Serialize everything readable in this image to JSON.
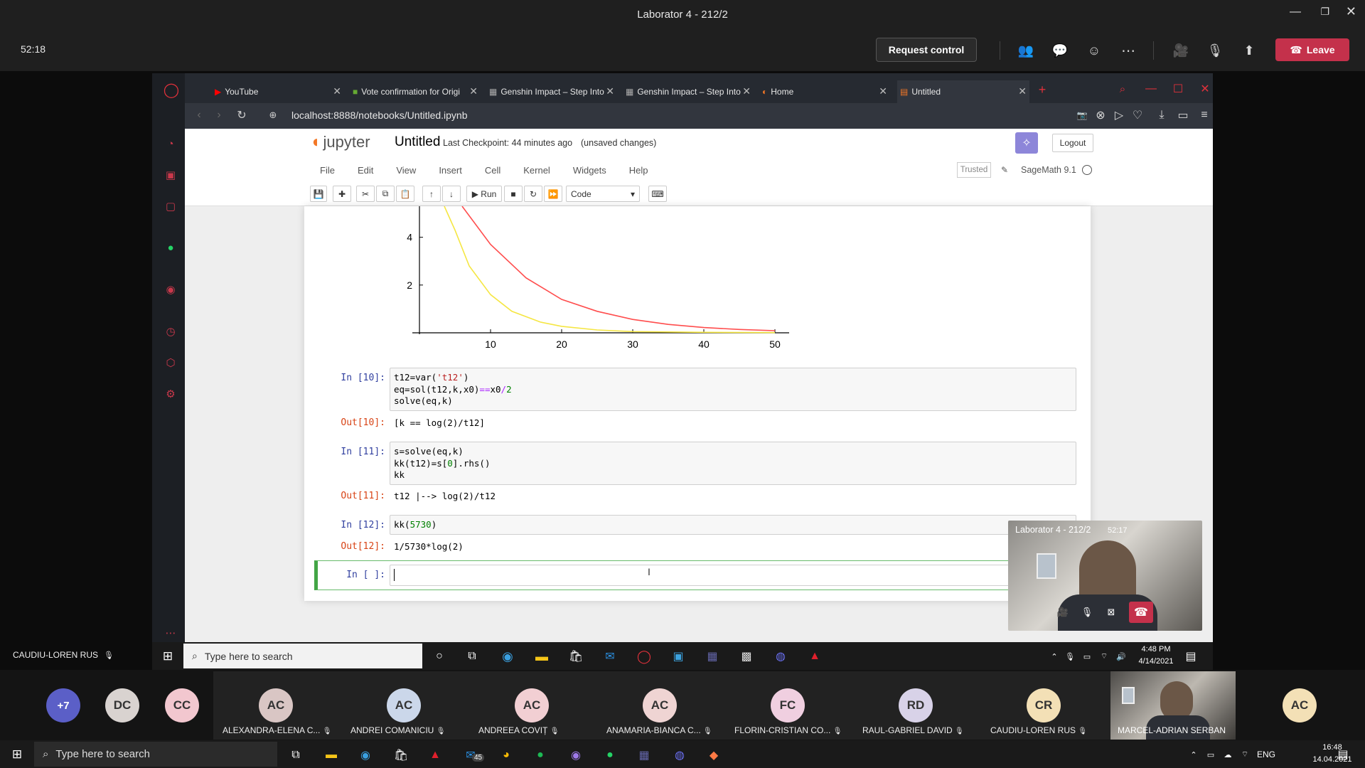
{
  "teams": {
    "window_title": "Laborator 4 - 212/2",
    "timer": "52:18",
    "request_control": "Request control",
    "leave": "Leave",
    "presenter_label": "CAUDIU-LOREN RUS"
  },
  "browser": {
    "tabs": [
      {
        "label": "YouTube"
      },
      {
        "label": "Vote confirmation for Origi"
      },
      {
        "label": "Genshin Impact – Step Into"
      },
      {
        "label": "Genshin Impact – Step Into"
      },
      {
        "label": "Home"
      },
      {
        "label": "Untitled"
      }
    ],
    "url": "localhost:8888/notebooks/Untitled.ipynb"
  },
  "jupyter": {
    "logo": "jupyter",
    "notebook_name": "Untitled",
    "checkpoint": "Last Checkpoint: 44 minutes ago",
    "unsaved": "(unsaved changes)",
    "logout": "Logout",
    "menu": [
      "File",
      "Edit",
      "View",
      "Insert",
      "Cell",
      "Kernel",
      "Widgets",
      "Help"
    ],
    "trusted": "Trusted",
    "kernel": "SageMath 9.1",
    "run": "Run",
    "cell_type": "Code"
  },
  "chart_data": {
    "type": "line",
    "x_ticks": [
      "10",
      "20",
      "30",
      "40",
      "50"
    ],
    "y_ticks": [
      "2",
      "4"
    ],
    "series": [
      {
        "color": "#ff4d4d",
        "points": [
          [
            6,
            5.3
          ],
          [
            10,
            3.7
          ],
          [
            15,
            2.3
          ],
          [
            20,
            1.4
          ],
          [
            25,
            0.9
          ],
          [
            30,
            0.56
          ],
          [
            35,
            0.35
          ],
          [
            40,
            0.22
          ],
          [
            45,
            0.14
          ],
          [
            50,
            0.09
          ]
        ]
      },
      {
        "color": "#f5e642",
        "points": [
          [
            3.5,
            5.3
          ],
          [
            5,
            4.3
          ],
          [
            7,
            2.8
          ],
          [
            10,
            1.6
          ],
          [
            13,
            0.9
          ],
          [
            17,
            0.45
          ],
          [
            20,
            0.27
          ],
          [
            25,
            0.12
          ],
          [
            30,
            0.05
          ],
          [
            40,
            0.02
          ],
          [
            50,
            0.01
          ]
        ]
      }
    ],
    "xlim": [
      0,
      52
    ],
    "ylim": [
      0,
      5.3
    ]
  },
  "cells": {
    "c10": {
      "in": "In [10]:",
      "out": "Out[10]:",
      "result": "[k == log(2)/t12]"
    },
    "c11": {
      "in": "In [11]:",
      "out": "Out[11]:",
      "result": "t12 |--> log(2)/t12"
    },
    "c12": {
      "in": "In [12]:",
      "out": "Out[12]:",
      "result": "1/5730*log(2)"
    },
    "c13": {
      "in": "In [ ]:"
    }
  },
  "video": {
    "title": "Laborator 4 - 212/2",
    "time": "52:17"
  },
  "remote_taskbar": {
    "search": "Type here to search",
    "time": "4:48 PM",
    "date": "4/14/2021"
  },
  "participants": [
    {
      "initials": "+7"
    },
    {
      "initials": "DC"
    },
    {
      "initials": "CC"
    },
    {
      "initials": "AC",
      "name": "ALEXANDRA-ELENA C..."
    },
    {
      "initials": "AC",
      "name": "ANDREI COMANICIU"
    },
    {
      "initials": "AC",
      "name": "ANDREEA COVIȚ"
    },
    {
      "initials": "AC",
      "name": "ANAMARIA-BIANCA C..."
    },
    {
      "initials": "FC",
      "name": "FLORIN-CRISTIAN CO..."
    },
    {
      "initials": "RD",
      "name": "RAUL-GABRIEL DAVID"
    },
    {
      "initials": "CR",
      "name": "CAUDIU-LOREN RUS"
    },
    {
      "name": "MARCEL-ADRIAN SERBAN"
    },
    {
      "initials": "AC"
    }
  ],
  "local_taskbar": {
    "search": "Type here to search",
    "badge": "45",
    "lang": "ENG",
    "time": "16:48",
    "date": "14.04.2021"
  }
}
